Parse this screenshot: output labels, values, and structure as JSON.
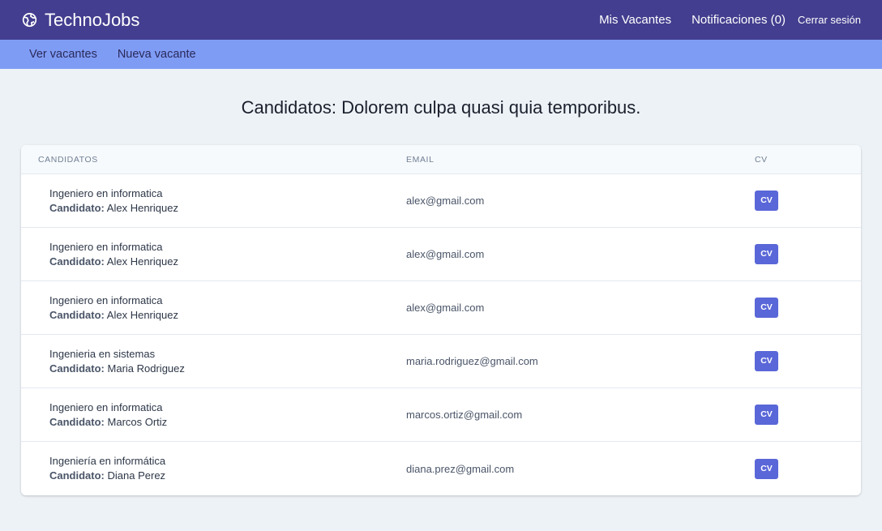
{
  "app": {
    "title": "TechnoJobs",
    "icon": "globe-icon"
  },
  "topnav": {
    "mis_vacantes": "Mis Vacantes",
    "notificaciones": "Notificaciones (0)",
    "cerrar_sesion": "Cerrar sesión"
  },
  "subnav": {
    "ver_vacantes": "Ver vacantes",
    "nueva_vacante": "Nueva vacante"
  },
  "page": {
    "title": "Candidatos: Dolorem culpa quasi quia temporibus."
  },
  "table": {
    "headers": {
      "candidatos": "CANDIDATOS",
      "email": "EMAIL",
      "cv": "CV"
    },
    "candidate_label": "Candidato:",
    "rows": [
      {
        "title": "Ingeniero en informatica",
        "name": "Alex Henriquez",
        "email": "alex@gmail.com",
        "cv": "CV"
      },
      {
        "title": "Ingeniero en informatica",
        "name": "Alex Henriquez",
        "email": "alex@gmail.com",
        "cv": "CV"
      },
      {
        "title": "Ingeniero en informatica",
        "name": "Alex Henriquez",
        "email": "alex@gmail.com",
        "cv": "CV"
      },
      {
        "title": "Ingenieria en sistemas",
        "name": "Maria Rodriguez",
        "email": "maria.rodriguez@gmail.com",
        "cv": "CV"
      },
      {
        "title": "Ingeniero en informatica",
        "name": "Marcos Ortiz",
        "email": "marcos.ortiz@gmail.com",
        "cv": "CV"
      },
      {
        "title": "Ingeniería en informática",
        "name": "Diana Perez",
        "email": "diana.prez@gmail.com",
        "cv": "CV"
      }
    ]
  },
  "colors": {
    "topbar": "#433e8f",
    "subnav": "#7f9cf5",
    "button": "#5a67d8",
    "background": "#edf2f7"
  }
}
